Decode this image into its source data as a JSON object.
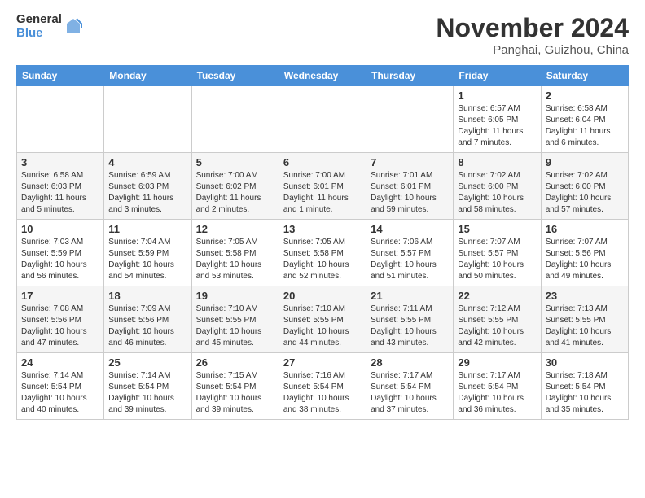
{
  "logo": {
    "general": "General",
    "blue": "Blue"
  },
  "header": {
    "month": "November 2024",
    "location": "Panghai, Guizhou, China"
  },
  "weekdays": [
    "Sunday",
    "Monday",
    "Tuesday",
    "Wednesday",
    "Thursday",
    "Friday",
    "Saturday"
  ],
  "weeks": [
    [
      {
        "num": "",
        "info": ""
      },
      {
        "num": "",
        "info": ""
      },
      {
        "num": "",
        "info": ""
      },
      {
        "num": "",
        "info": ""
      },
      {
        "num": "",
        "info": ""
      },
      {
        "num": "1",
        "info": "Sunrise: 6:57 AM\nSunset: 6:05 PM\nDaylight: 11 hours and 7 minutes."
      },
      {
        "num": "2",
        "info": "Sunrise: 6:58 AM\nSunset: 6:04 PM\nDaylight: 11 hours and 6 minutes."
      }
    ],
    [
      {
        "num": "3",
        "info": "Sunrise: 6:58 AM\nSunset: 6:03 PM\nDaylight: 11 hours and 5 minutes."
      },
      {
        "num": "4",
        "info": "Sunrise: 6:59 AM\nSunset: 6:03 PM\nDaylight: 11 hours and 3 minutes."
      },
      {
        "num": "5",
        "info": "Sunrise: 7:00 AM\nSunset: 6:02 PM\nDaylight: 11 hours and 2 minutes."
      },
      {
        "num": "6",
        "info": "Sunrise: 7:00 AM\nSunset: 6:01 PM\nDaylight: 11 hours and 1 minute."
      },
      {
        "num": "7",
        "info": "Sunrise: 7:01 AM\nSunset: 6:01 PM\nDaylight: 10 hours and 59 minutes."
      },
      {
        "num": "8",
        "info": "Sunrise: 7:02 AM\nSunset: 6:00 PM\nDaylight: 10 hours and 58 minutes."
      },
      {
        "num": "9",
        "info": "Sunrise: 7:02 AM\nSunset: 6:00 PM\nDaylight: 10 hours and 57 minutes."
      }
    ],
    [
      {
        "num": "10",
        "info": "Sunrise: 7:03 AM\nSunset: 5:59 PM\nDaylight: 10 hours and 56 minutes."
      },
      {
        "num": "11",
        "info": "Sunrise: 7:04 AM\nSunset: 5:59 PM\nDaylight: 10 hours and 54 minutes."
      },
      {
        "num": "12",
        "info": "Sunrise: 7:05 AM\nSunset: 5:58 PM\nDaylight: 10 hours and 53 minutes."
      },
      {
        "num": "13",
        "info": "Sunrise: 7:05 AM\nSunset: 5:58 PM\nDaylight: 10 hours and 52 minutes."
      },
      {
        "num": "14",
        "info": "Sunrise: 7:06 AM\nSunset: 5:57 PM\nDaylight: 10 hours and 51 minutes."
      },
      {
        "num": "15",
        "info": "Sunrise: 7:07 AM\nSunset: 5:57 PM\nDaylight: 10 hours and 50 minutes."
      },
      {
        "num": "16",
        "info": "Sunrise: 7:07 AM\nSunset: 5:56 PM\nDaylight: 10 hours and 49 minutes."
      }
    ],
    [
      {
        "num": "17",
        "info": "Sunrise: 7:08 AM\nSunset: 5:56 PM\nDaylight: 10 hours and 47 minutes."
      },
      {
        "num": "18",
        "info": "Sunrise: 7:09 AM\nSunset: 5:56 PM\nDaylight: 10 hours and 46 minutes."
      },
      {
        "num": "19",
        "info": "Sunrise: 7:10 AM\nSunset: 5:55 PM\nDaylight: 10 hours and 45 minutes."
      },
      {
        "num": "20",
        "info": "Sunrise: 7:10 AM\nSunset: 5:55 PM\nDaylight: 10 hours and 44 minutes."
      },
      {
        "num": "21",
        "info": "Sunrise: 7:11 AM\nSunset: 5:55 PM\nDaylight: 10 hours and 43 minutes."
      },
      {
        "num": "22",
        "info": "Sunrise: 7:12 AM\nSunset: 5:55 PM\nDaylight: 10 hours and 42 minutes."
      },
      {
        "num": "23",
        "info": "Sunrise: 7:13 AM\nSunset: 5:55 PM\nDaylight: 10 hours and 41 minutes."
      }
    ],
    [
      {
        "num": "24",
        "info": "Sunrise: 7:14 AM\nSunset: 5:54 PM\nDaylight: 10 hours and 40 minutes."
      },
      {
        "num": "25",
        "info": "Sunrise: 7:14 AM\nSunset: 5:54 PM\nDaylight: 10 hours and 39 minutes."
      },
      {
        "num": "26",
        "info": "Sunrise: 7:15 AM\nSunset: 5:54 PM\nDaylight: 10 hours and 39 minutes."
      },
      {
        "num": "27",
        "info": "Sunrise: 7:16 AM\nSunset: 5:54 PM\nDaylight: 10 hours and 38 minutes."
      },
      {
        "num": "28",
        "info": "Sunrise: 7:17 AM\nSunset: 5:54 PM\nDaylight: 10 hours and 37 minutes."
      },
      {
        "num": "29",
        "info": "Sunrise: 7:17 AM\nSunset: 5:54 PM\nDaylight: 10 hours and 36 minutes."
      },
      {
        "num": "30",
        "info": "Sunrise: 7:18 AM\nSunset: 5:54 PM\nDaylight: 10 hours and 35 minutes."
      }
    ]
  ]
}
